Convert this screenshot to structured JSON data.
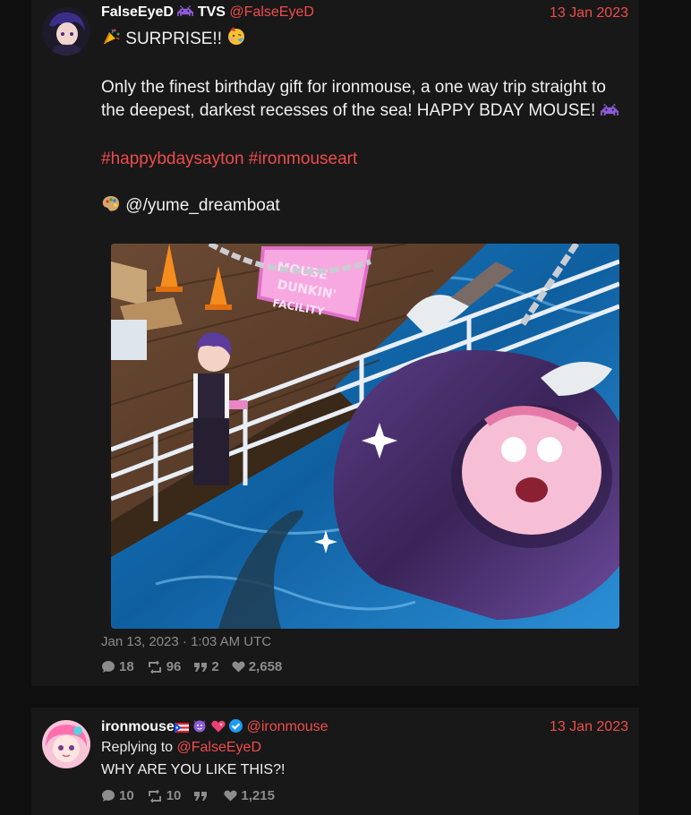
{
  "tweet1": {
    "display_name": "FalseEyeD",
    "name_suffix": "TVS",
    "handle": "@FalseEyeD",
    "date": "13 Jan 2023",
    "line1": "SURPRISE!!",
    "para": "Only the finest birthday gift for ironmouse, a one way trip straight to the deepest, darkest recesses of the sea! HAPPY BDAY MOUSE!",
    "hashtag1": "#happybdaysayton",
    "hashtag2": "#ironmouseart",
    "credit": "@/yume_dreamboat",
    "timestamp": "Jan 13, 2023 · 1:03 AM UTC",
    "stats": {
      "replies": "18",
      "retweets": "96",
      "quotes": "2",
      "likes": "2,658"
    }
  },
  "tweet2": {
    "display_name": "ironmouse",
    "handle": "@ironmouse",
    "date": "13 Jan 2023",
    "replying_prefix": "Replying to",
    "replying_handle": "@FalseEyeD",
    "text": "WHY ARE YOU LIKE THIS?!",
    "stats": {
      "replies": "10",
      "retweets": "10",
      "quotes": "",
      "likes": "1,215"
    }
  },
  "colors": {
    "accent": "#ef4b4b",
    "background": "#0f0f0f",
    "card": "#181818",
    "muted": "#8c8c8c"
  }
}
